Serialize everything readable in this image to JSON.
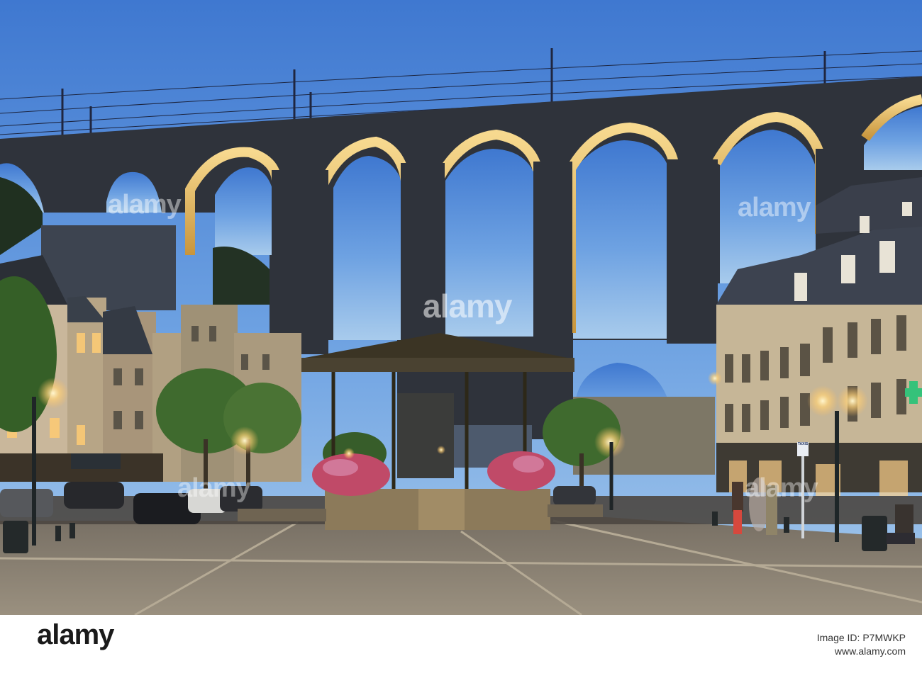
{
  "watermarks": {
    "center": "alamy",
    "top_left": "alamy",
    "top_right": "alamy",
    "bottom_left": "alamy",
    "bottom_right": "alamy"
  },
  "sign": {
    "taxis": "TAXIS"
  },
  "footer": {
    "logo": "alamy",
    "image_id": "Image ID: P7MWKP",
    "url": "www.alamy.com"
  },
  "colors": {
    "sky_top": "#3f79d2",
    "sky_bottom": "#9cc4ea",
    "viaduct": "#31343d",
    "arch_glow": "#f4d285",
    "plaza": "#8e8475",
    "bandstand": "#3d3525",
    "flowers": "#c1506a"
  },
  "icons": {
    "logo": "alamy-logo",
    "pharmacy": "pharmacy-cross-icon"
  }
}
